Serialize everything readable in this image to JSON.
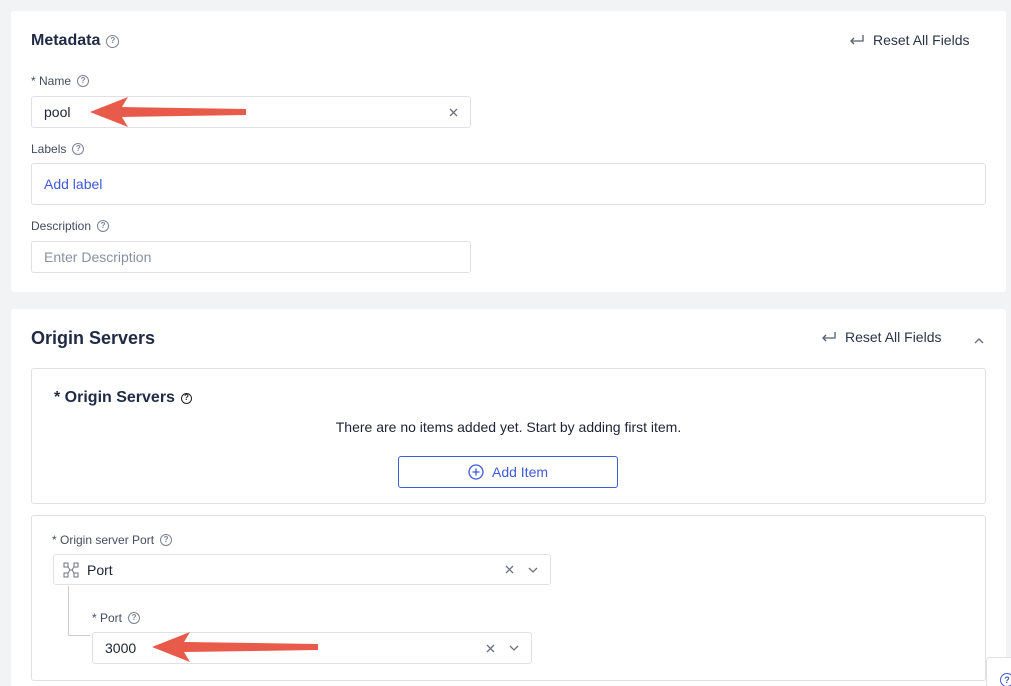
{
  "metadata": {
    "title": "Metadata",
    "reset_label": "Reset All Fields",
    "name": {
      "label": "* Name",
      "value": "pool"
    },
    "labels": {
      "label": "Labels",
      "add_label": "Add label"
    },
    "description": {
      "label": "Description",
      "placeholder": "Enter Description"
    }
  },
  "origin_servers": {
    "title": "Origin Servers",
    "reset_label": "Reset All Fields",
    "list": {
      "title": "* Origin Servers",
      "empty_text": "There are no items added yet. Start by adding first item.",
      "add_item_label": "Add Item"
    },
    "port_section": {
      "label": "* Origin server Port",
      "selected": "Port",
      "port": {
        "label": "* Port",
        "value": "3000"
      }
    }
  },
  "colors": {
    "accent": "#3f5bd9",
    "arrow": "#e85a4a"
  }
}
